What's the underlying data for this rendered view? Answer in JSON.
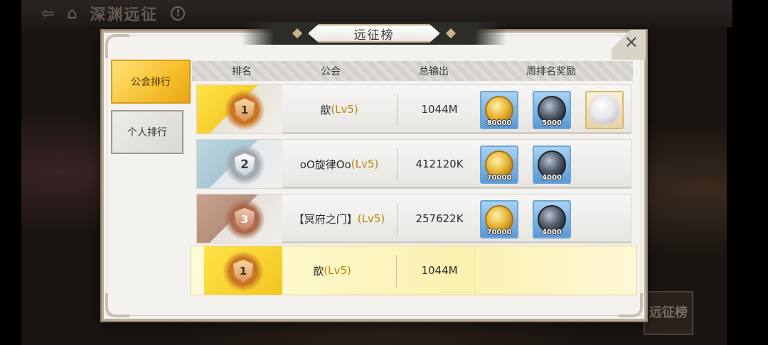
{
  "background": {
    "title": "深渊远征",
    "home_icon": "home-icon",
    "info_icon": "info-icon",
    "back_icon": "back-icon",
    "corner_button": "远征榜"
  },
  "dialog": {
    "title": "远征榜",
    "close_icon": "close-icon"
  },
  "tabs": [
    {
      "label": "公会排行",
      "active": true
    },
    {
      "label": "个人排行",
      "active": false
    }
  ],
  "table": {
    "headers": [
      "排名",
      "公会",
      "总输出",
      "周排名奖励"
    ],
    "rows": [
      {
        "rank": "1",
        "guild": "歆",
        "level": "(Lv5)",
        "damage": "1044M",
        "rewards": [
          {
            "type": "gold-coin-icon",
            "qty": "80000"
          },
          {
            "type": "crystal-icon",
            "qty": "5000"
          },
          {
            "type": "avatar-frame-icon",
            "qty": ""
          }
        ]
      },
      {
        "rank": "2",
        "guild": "oO旋律Oo",
        "level": "(Lv5)",
        "damage": "412120K",
        "rewards": [
          {
            "type": "gold-coin-icon",
            "qty": "70000"
          },
          {
            "type": "crystal-icon",
            "qty": "4000"
          }
        ]
      },
      {
        "rank": "3",
        "guild": "【冥府之门】",
        "level": "(Lv5)",
        "damage": "257622K",
        "rewards": [
          {
            "type": "gold-coin-icon",
            "qty": "70000"
          },
          {
            "type": "crystal-icon",
            "qty": "4000"
          }
        ]
      }
    ],
    "my_row": {
      "rank": "1",
      "guild": "歆",
      "level": "(Lv5)",
      "damage": "1044M"
    }
  }
}
